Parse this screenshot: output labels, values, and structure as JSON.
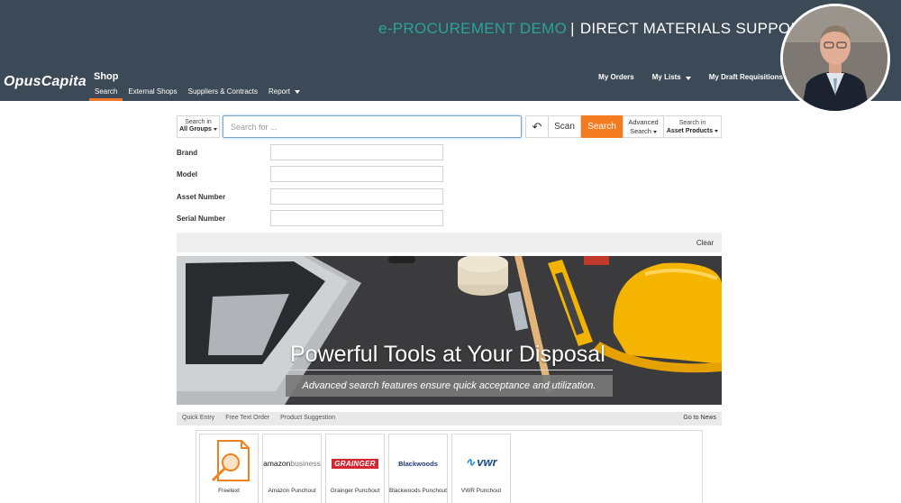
{
  "header": {
    "demo_accent": "e-PROCUREMENT  DEMO",
    "demo_separator": "|",
    "demo_main": "DIRECT MATERIALS SUPPORT",
    "logo": "OpusCapita",
    "section": "Shop",
    "nav": [
      {
        "label": "Search"
      },
      {
        "label": "External Shops"
      },
      {
        "label": "Suppliers & Contracts"
      },
      {
        "label": "Report"
      }
    ],
    "right_nav": [
      {
        "label": "My Orders"
      },
      {
        "label": "My Lists"
      },
      {
        "label": "My Draft Requisitions"
      }
    ]
  },
  "search": {
    "search_in_label": "Search in",
    "search_in_value": "All Groups",
    "placeholder": "Search for ...",
    "scan_label": "Scan",
    "search_button": "Search",
    "advanced_label": "Advanced",
    "advanced_sub": "Search",
    "search_in2_label": "Search in",
    "search_in2_value": "Asset Products"
  },
  "fields": [
    {
      "label": "Brand",
      "value": ""
    },
    {
      "label": "Model",
      "value": ""
    },
    {
      "label": "Asset Number",
      "value": ""
    },
    {
      "label": "Serial Number",
      "value": ""
    }
  ],
  "clear_label": "Clear",
  "banner": {
    "headline": "Powerful Tools at Your Disposal",
    "subline": "Advanced search features ensure quick acceptance and utilization."
  },
  "bottom_tabs": [
    "Quick Entry",
    "Free Text Order",
    "Product Suggestion"
  ],
  "go_to_news": "Go to News",
  "tiles": [
    {
      "label": "Freetext",
      "icon": "freetext-icon"
    },
    {
      "label": "Amazon Punchout",
      "logo_a": "amazon",
      "logo_b": "business"
    },
    {
      "label": "Grainger Punchout",
      "logo": "GRAINGER"
    },
    {
      "label": "Blackwoods Punchout",
      "logo": "Blackwoods"
    },
    {
      "label": "VWR Punchout",
      "logo": "vwr"
    }
  ],
  "colors": {
    "header_bg": "#3c4a57",
    "accent_teal": "#2aa39a",
    "accent_orange": "#f47b20"
  }
}
